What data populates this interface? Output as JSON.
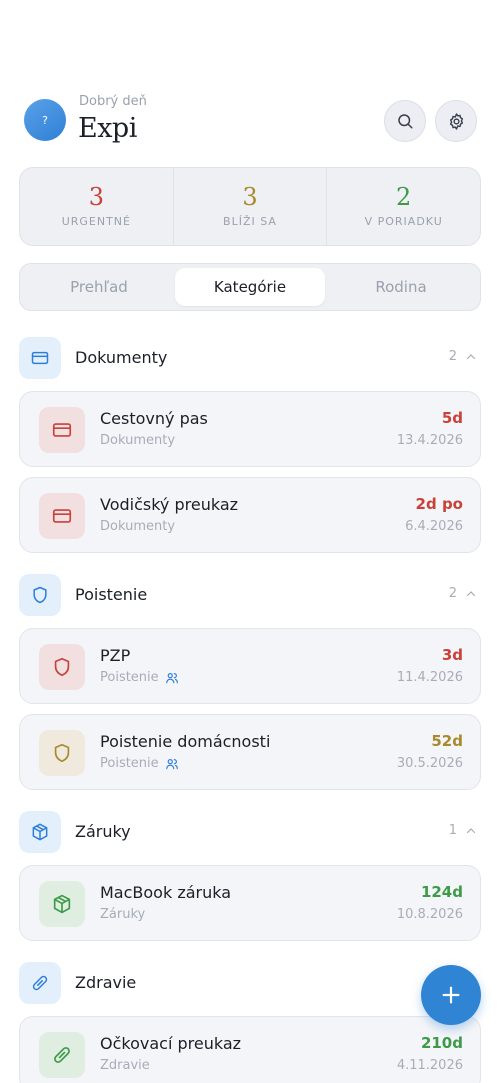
{
  "header": {
    "avatar_text": "?",
    "greeting": "Dobrý deň",
    "app_name": "Expi",
    "search_icon": "search-icon",
    "settings_icon": "gear-icon"
  },
  "stats": [
    {
      "value": "3",
      "label": "URGENTNÉ",
      "color": "#c8413a"
    },
    {
      "value": "3",
      "label": "BLÍŽI SA",
      "color": "#a88a2c"
    },
    {
      "value": "2",
      "label": "V PORIADKU",
      "color": "#3d9a48"
    }
  ],
  "tabs": [
    {
      "label": "Prehľad",
      "active": false
    },
    {
      "label": "Kategórie",
      "active": true
    },
    {
      "label": "Rodina",
      "active": false
    }
  ],
  "categories": [
    {
      "title": "Dokumenty",
      "count": "2",
      "icon": "card-icon",
      "items": [
        {
          "title": "Cestovný pas",
          "subtitle": "Dokumenty",
          "days": "5d",
          "date": "13.4.2026",
          "status": "red",
          "icon": "card-icon",
          "shared": false
        },
        {
          "title": "Vodičský preukaz",
          "subtitle": "Dokumenty",
          "days": "2d po",
          "date": "6.4.2026",
          "status": "red",
          "icon": "card-icon",
          "shared": false
        }
      ]
    },
    {
      "title": "Poistenie",
      "count": "2",
      "icon": "shield-icon",
      "items": [
        {
          "title": "PZP",
          "subtitle": "Poistenie",
          "days": "3d",
          "date": "11.4.2026",
          "status": "red",
          "icon": "shield-icon",
          "shared": true
        },
        {
          "title": "Poistenie domácnosti",
          "subtitle": "Poistenie",
          "days": "52d",
          "date": "30.5.2026",
          "status": "gold",
          "icon": "shield-icon",
          "shared": true
        }
      ]
    },
    {
      "title": "Záruky",
      "count": "1",
      "icon": "box-icon",
      "items": [
        {
          "title": "MacBook záruka",
          "subtitle": "Záruky",
          "days": "124d",
          "date": "10.8.2026",
          "status": "green",
          "icon": "box-icon",
          "shared": false
        }
      ]
    },
    {
      "title": "Zdravie",
      "count": "",
      "icon": "pill-icon",
      "items": [
        {
          "title": "Očkovací preukaz",
          "subtitle": "Zdravie",
          "days": "210d",
          "date": "4.11.2026",
          "status": "green",
          "icon": "pill-icon",
          "shared": false
        }
      ]
    }
  ],
  "fab_icon": "plus-icon",
  "colors": {
    "red": "#c8413a",
    "gold": "#a88a2c",
    "green": "#3d9a48",
    "accent": "#2f84d4"
  }
}
